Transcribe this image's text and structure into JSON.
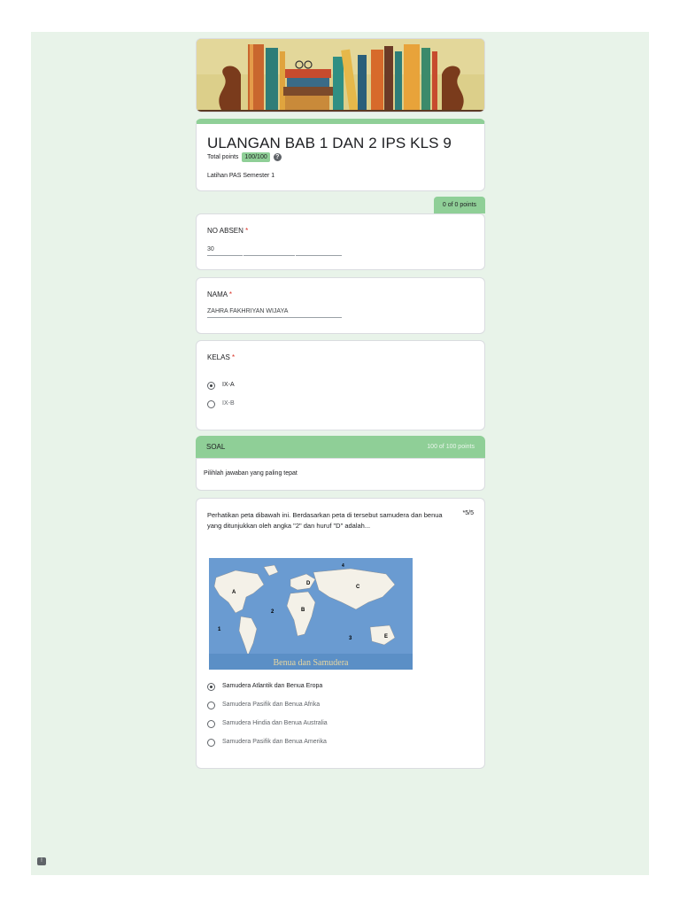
{
  "form": {
    "title": "ULANGAN BAB 1 DAN 2 IPS KLS 9",
    "total_points_label": "Total points",
    "total_points_value": "100/100",
    "help_icon": "?",
    "description": "Latihan PAS Semester 1",
    "points_tab": "0 of 0 points",
    "colors": {
      "accent": "#8fcf97",
      "background": "#e8f3e9",
      "required": "#d93025"
    }
  },
  "questions": {
    "absen": {
      "label": "NO ABSEN",
      "required": "*",
      "value": "30"
    },
    "nama": {
      "label": "NAMA",
      "required": "*",
      "value": "ZAHRA FAKHRIYAN WIJAYA"
    },
    "kelas": {
      "label": "KELAS",
      "required": "*",
      "options": [
        "IX-A",
        "IX-B"
      ],
      "selected": "IX-A"
    }
  },
  "section": {
    "title": "SOAL",
    "points": "100 of 100 points",
    "description": "Pilihlah jawaban yang paling tepat"
  },
  "q1": {
    "text": "Perhatikan peta dibawah ini. Berdasarkan peta di tersebut samudera dan benua yang ditunjukkan oleh angka \"2\" dan huruf \"D\"  adalah...",
    "score": "*5/5",
    "map_caption": "Benua dan Samudera",
    "map_labels": [
      "1",
      "2",
      "3",
      "4",
      "A",
      "B",
      "C",
      "D",
      "E"
    ],
    "options": [
      "Samudera Atlantik dan Benua Eropa",
      "Samudera Pasifik dan Benua Afrika",
      "Samudera Hindia dan Benua Australia",
      "Samudera Pasifik dan Benua Amerika"
    ],
    "selected": "Samudera Atlantik dan Benua Eropa"
  }
}
